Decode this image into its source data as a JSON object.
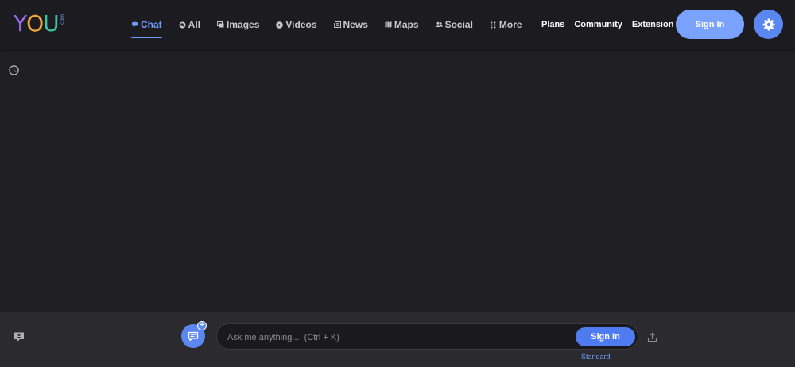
{
  "brand": {
    "logo_y": "Y",
    "logo_o": "O",
    "logo_u": "U",
    "logo_suffix": "com"
  },
  "nav": {
    "items": [
      {
        "label": "Chat",
        "icon": "chat-icon",
        "active": true
      },
      {
        "label": "All",
        "icon": "search-icon"
      },
      {
        "label": "Images",
        "icon": "images-icon"
      },
      {
        "label": "Videos",
        "icon": "play-icon"
      },
      {
        "label": "News",
        "icon": "news-icon"
      },
      {
        "label": "Maps",
        "icon": "map-icon"
      },
      {
        "label": "Social",
        "icon": "people-icon"
      },
      {
        "label": "More",
        "icon": "grid-dots-icon"
      }
    ]
  },
  "header_links": {
    "plans": "Plans",
    "community": "Community",
    "extension": "Extension"
  },
  "header_buttons": {
    "sign_in": "Sign In",
    "settings_icon": "gear-icon"
  },
  "composer": {
    "placeholder": "Ask me anything...  (Ctrl + K)",
    "sign_in": "Sign In",
    "mode": "Standard"
  },
  "colors": {
    "background": "#201f24",
    "header": "#1c1b20",
    "accent": "#6f9bff",
    "button_primary": "#7aa2ff",
    "button_blue": "#5b87f2",
    "bottom_bar": "#2b2a2f"
  }
}
